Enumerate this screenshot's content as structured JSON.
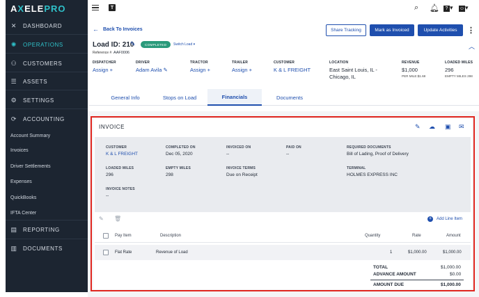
{
  "brand": {
    "name_a": "A",
    "name_x": "X",
    "name_rest": "ELE",
    "name_pro": "PRO"
  },
  "sidebar": {
    "items": [
      {
        "label": "DASHBOARD",
        "icon": "close-x-icon"
      },
      {
        "label": "OPERATIONS",
        "icon": "gear-cluster-icon",
        "active": true
      },
      {
        "label": "CUSTOMERS",
        "icon": "people-icon"
      },
      {
        "label": "ASSETS",
        "icon": "server-icon"
      },
      {
        "label": "SETTINGS",
        "icon": "gear-icon"
      },
      {
        "label": "ACCOUNTING",
        "icon": "dollar-cycle-icon"
      },
      {
        "label": "REPORTING",
        "icon": "report-icon"
      },
      {
        "label": "DOCUMENTS",
        "icon": "document-icon"
      }
    ],
    "accounting_sub": [
      "Account Summary",
      "Invoices",
      "Driver Settlements",
      "Expenses",
      "QuickBooks",
      "IFTA Center"
    ]
  },
  "topbar": {
    "tbox": "T",
    "icons": [
      "search-icon",
      "bell-icon",
      "help-icon",
      "user-icon"
    ]
  },
  "header": {
    "back_label": "Back To Invoices",
    "buttons": {
      "share": "Share Tracking",
      "mark": "Mark as Invoiced",
      "update": "Update Activities"
    },
    "load_id": "Load ID: 210",
    "status": "COMPLETED",
    "switch_load": "Switch Load",
    "reference_label": "Reference #",
    "reference_value": "AAF0006"
  },
  "fields": {
    "dispatcher": {
      "label": "DISPATCHER",
      "value": "Assign"
    },
    "driver": {
      "label": "DRIVER",
      "value": "Adam Avila"
    },
    "tractor": {
      "label": "TRACTOR",
      "value": "Assign"
    },
    "trailer": {
      "label": "TRAILER",
      "value": "Assign"
    },
    "customer": {
      "label": "CUSTOMER",
      "value": "K & L FREIGHT"
    },
    "location": {
      "label": "LOCATION",
      "value_1": "East Saint Louis, IL -",
      "value_2": "Chicago, IL"
    },
    "revenue": {
      "label": "REVENUE",
      "value": "$1,000",
      "sub": "PER MILE:$1.68"
    },
    "loaded_miles": {
      "label": "LOADED MILES",
      "value": "296",
      "sub": "EMPTY MILES 298"
    }
  },
  "tabs": [
    {
      "label": "General Info"
    },
    {
      "label": "Stops on Load"
    },
    {
      "label": "Financials",
      "active": true
    },
    {
      "label": "Documents"
    }
  ],
  "invoice": {
    "title": "INVOICE",
    "summary": {
      "customer": {
        "label": "CUSTOMER",
        "value": "K & L FREIGHT"
      },
      "completed_on": {
        "label": "COMPLETED ON",
        "value": "Dec 05, 2020"
      },
      "invoiced_on": {
        "label": "INVOICED ON",
        "value": "--"
      },
      "paid_on": {
        "label": "PAID ON",
        "value": "--"
      },
      "required_documents": {
        "label": "REQUIRED DOCUMENTS",
        "value": "Bill of Lading, Proof of Delivery"
      },
      "loaded_miles": {
        "label": "LOADED MILES",
        "value": "296"
      },
      "empty_miles": {
        "label": "EMPTY MILES",
        "value": "298"
      },
      "invoice_terms": {
        "label": "INVOICE TERMS",
        "value": "Due on Receipt"
      },
      "terminal": {
        "label": "TERMINAL",
        "value": "HOLMES EXPRESS INC"
      },
      "invoice_notes": {
        "label": "INVOICE NOTES",
        "value": "--"
      }
    },
    "add_line_item": "Add Line Item",
    "columns": {
      "pay_item": "Pay Item",
      "description": "Description",
      "quantity": "Quantity",
      "rate": "Rate",
      "amount": "Amount"
    },
    "rows": [
      {
        "pay_item": "Flat Rate",
        "description": "Revenue of Load",
        "quantity": "1",
        "rate": "$1,000.00",
        "amount": "$1,000.00"
      }
    ],
    "totals": {
      "total_label": "TOTAL",
      "total_value": "$1,000.00",
      "advance_label": "ADVANCE AMOUNT",
      "advance_value": "$0.00",
      "due_label": "AMOUNT DUE",
      "due_value": "$1,000.00"
    }
  },
  "colors": {
    "accent": "#1f4fae",
    "sidebar_bg": "#1c2531",
    "brand_teal": "#2fc1c9",
    "completed_green": "#2b9a7b",
    "highlight_red": "#e0261f"
  }
}
